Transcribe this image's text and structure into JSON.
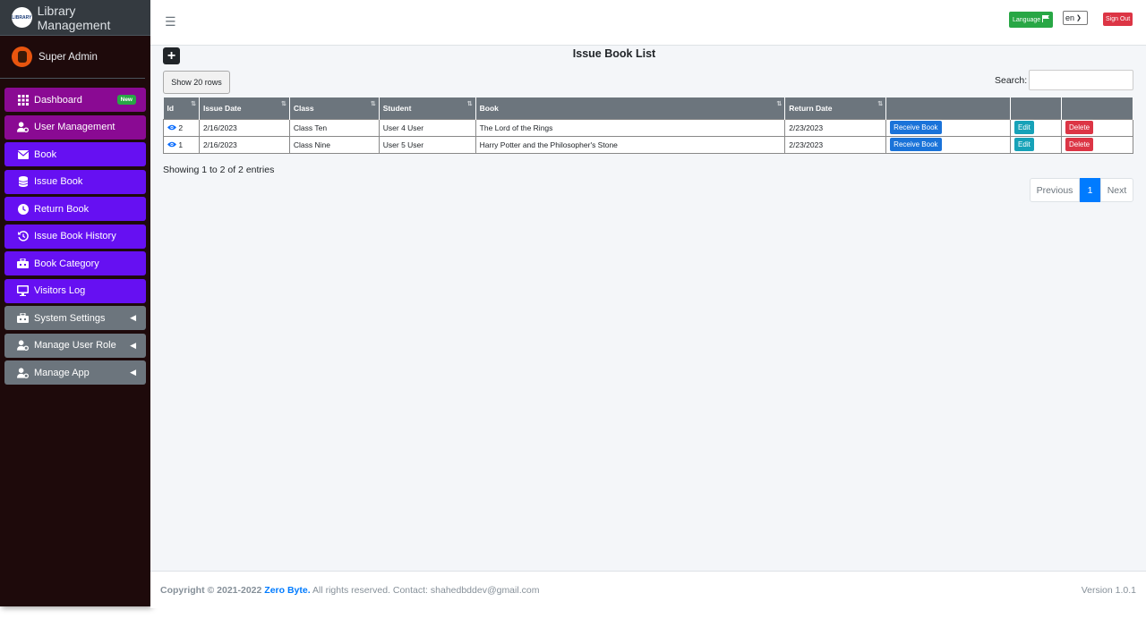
{
  "brand": {
    "logo_text": "LIBRARY",
    "title": "Library Management"
  },
  "user": {
    "name": "Super Admin"
  },
  "sidebar": {
    "items": [
      {
        "label": "Dashboard",
        "badge": "New",
        "icon": "grid-icon"
      },
      {
        "label": "User Management",
        "icon": "user-cog-icon"
      },
      {
        "label": "Book",
        "icon": "envelope-icon"
      },
      {
        "label": "Issue Book",
        "icon": "database-icon"
      },
      {
        "label": "Return Book",
        "icon": "clock-icon"
      },
      {
        "label": "Issue Book History",
        "icon": "history-icon"
      },
      {
        "label": "Book Category",
        "icon": "toolbox-icon"
      },
      {
        "label": "Visitors Log",
        "icon": "desktop-icon"
      },
      {
        "label": "System Settings",
        "icon": "toolbox-icon"
      },
      {
        "label": "Manage User Role",
        "icon": "user-cog-icon"
      },
      {
        "label": "Manage App",
        "icon": "user-cog-icon"
      }
    ]
  },
  "topbar": {
    "language_label": "Language",
    "language_value": "en",
    "signout_label": "Sign Out"
  },
  "page": {
    "title": "Issue Book List",
    "show_rows_label": "Show 20 rows",
    "search_label": "Search:",
    "search_value": "",
    "showing_text": "Showing 1 to 2 of 2 entries"
  },
  "table": {
    "headers": [
      "Id",
      "Issue Date",
      "Class",
      "Student",
      "Book",
      "Return Date"
    ],
    "rows": [
      {
        "id": "2",
        "issue_date": "2/16/2023",
        "class": "Class Ten",
        "student": "User 4 User",
        "book": "The Lord of the Rings",
        "return_date": "2/23/2023"
      },
      {
        "id": "1",
        "issue_date": "2/16/2023",
        "class": "Class Nine",
        "student": "User 5 User",
        "book": "Harry Potter and the Philosopher's Stone",
        "return_date": "2/23/2023"
      }
    ],
    "actions": {
      "receive": "Receive Book",
      "edit": "Edit",
      "delete": "Delete"
    }
  },
  "pagination": {
    "previous": "Previous",
    "current": "1",
    "next": "Next"
  },
  "footer": {
    "copyright_prefix": "Copyright © 2021-2022",
    "brand": "Zero Byte.",
    "suffix": "All rights reserved. Contact: shahedbddev@gmail.com",
    "version_label": "Version",
    "version": "1.0.1"
  },
  "colors": {
    "sidebar_bg": "#1e0a0b",
    "purple": "#8a0a93",
    "violet": "#6610f2",
    "grey": "#6c757d",
    "primary": "#007bff"
  }
}
